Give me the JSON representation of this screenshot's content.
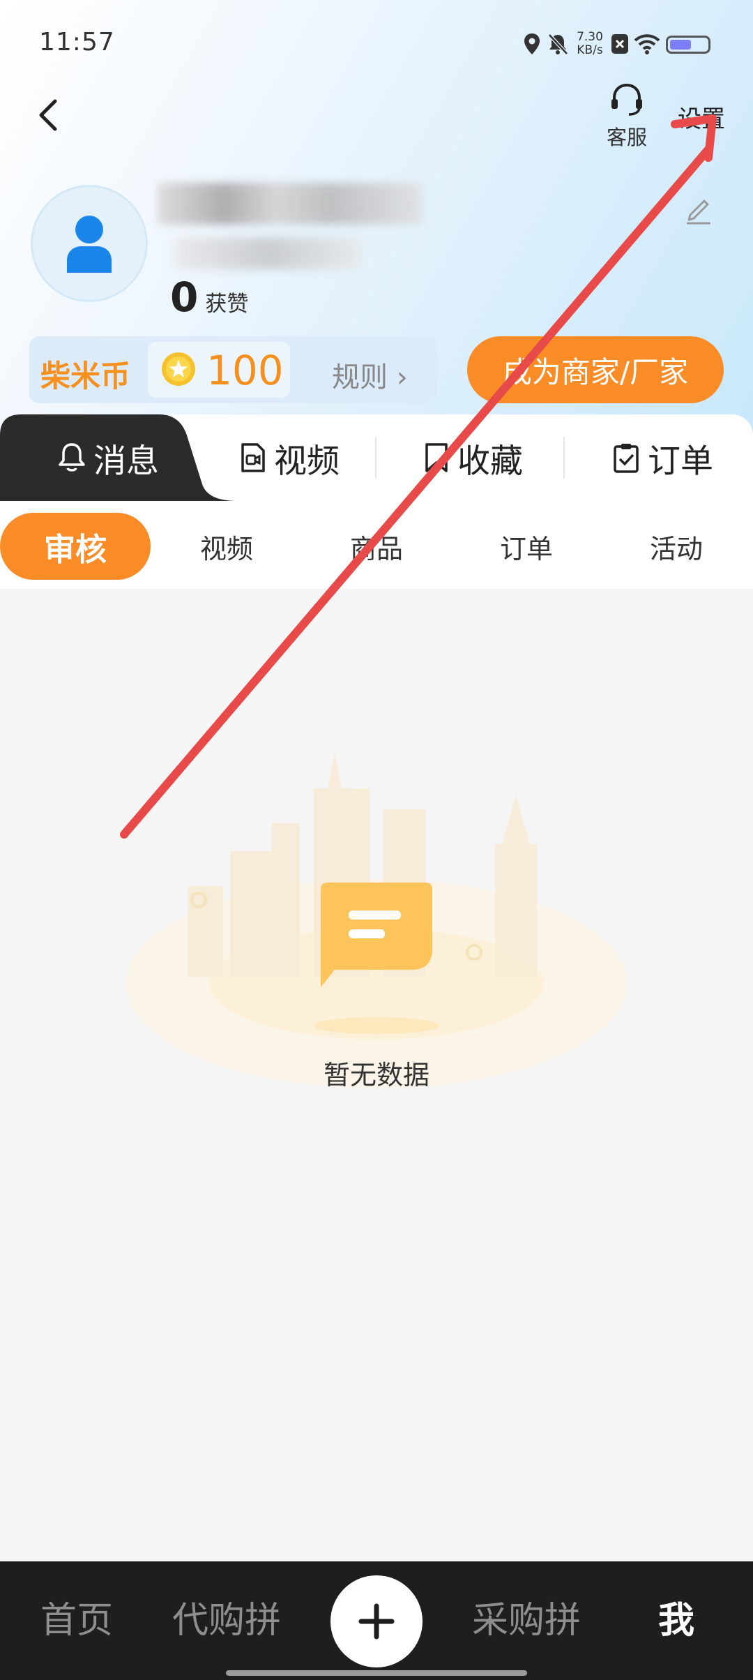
{
  "status_bar": {
    "time": "11:57",
    "net_speed_value": "7.30",
    "net_speed_unit": "KB/s"
  },
  "header": {
    "service_label": "客服",
    "settings_label": "设置"
  },
  "profile": {
    "likes_count": "0",
    "likes_label": "获赞"
  },
  "coins": {
    "title": "柴米币",
    "value": "100",
    "rule_label": "规则 ›"
  },
  "merchant_button": "成为商家/厂家",
  "main_tabs": [
    {
      "label": "消息",
      "icon": "bell-icon"
    },
    {
      "label": "视频",
      "icon": "video-file-icon"
    },
    {
      "label": "收藏",
      "icon": "bookmark-icon"
    },
    {
      "label": "订单",
      "icon": "clipboard-check-icon"
    }
  ],
  "sub_tabs": [
    "审核",
    "视频",
    "商品",
    "订单",
    "活动"
  ],
  "empty_state": {
    "text": "暂无数据"
  },
  "bottom_nav": [
    {
      "label": "首页"
    },
    {
      "label": "代购拼"
    },
    {
      "label": "采购拼"
    },
    {
      "label": "我"
    }
  ],
  "colors": {
    "accent_orange": "#fa8c27",
    "coin_orange": "#f5901e",
    "dark_tab": "#2b2b2b",
    "nav_bg": "#1e1e1e",
    "annotation_red": "#e84a4a"
  }
}
